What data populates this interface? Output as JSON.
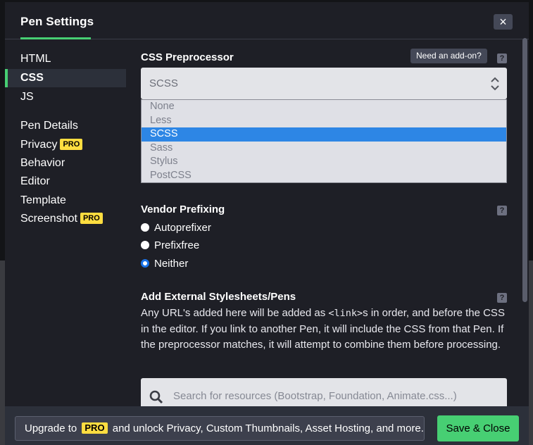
{
  "header": {
    "title": "Pen Settings",
    "close_label": "×"
  },
  "sidebar": {
    "items": [
      {
        "label": "HTML"
      },
      {
        "label": "CSS"
      },
      {
        "label": "JS"
      },
      {
        "label": "Pen Details"
      },
      {
        "label": "Privacy",
        "badge": "PRO"
      },
      {
        "label": "Behavior"
      },
      {
        "label": "Editor"
      },
      {
        "label": "Template"
      },
      {
        "label": "Screenshot",
        "badge": "PRO"
      }
    ],
    "active": "CSS"
  },
  "preprocessor": {
    "title": "CSS Preprocessor",
    "addon_label": "Need an add-on?",
    "help": "?",
    "selected": "SCSS",
    "options": [
      "None",
      "Less",
      "SCSS",
      "Sass",
      "Stylus",
      "PostCSS"
    ]
  },
  "vendor": {
    "title": "Vendor Prefixing",
    "help": "?",
    "options": [
      "Autoprefixer",
      "Prefixfree",
      "Neither"
    ],
    "selected": "Neither"
  },
  "external": {
    "title": "Add External Stylesheets/Pens",
    "help": "?",
    "desc_before": "Any URL's added here will be added as ",
    "desc_code": "<link>",
    "desc_after": "s in order, and before the CSS in the editor. If you link to another Pen, it will include the CSS from that Pen. If the preprocessor matches, it will attempt to combine them before processing.",
    "search_placeholder": "Search for resources (Bootstrap, Foundation, Animate.css...)"
  },
  "footer": {
    "upgrade_before": "Upgrade to",
    "upgrade_badge": "PRO",
    "upgrade_after": "and unlock Privacy, Custom Thumbnails, Asset Hosting, and more.",
    "save_label": "Save & Close"
  },
  "colors": {
    "accent": "#47cf73",
    "pro": "#ffdd40",
    "selected": "#2d86e5"
  }
}
